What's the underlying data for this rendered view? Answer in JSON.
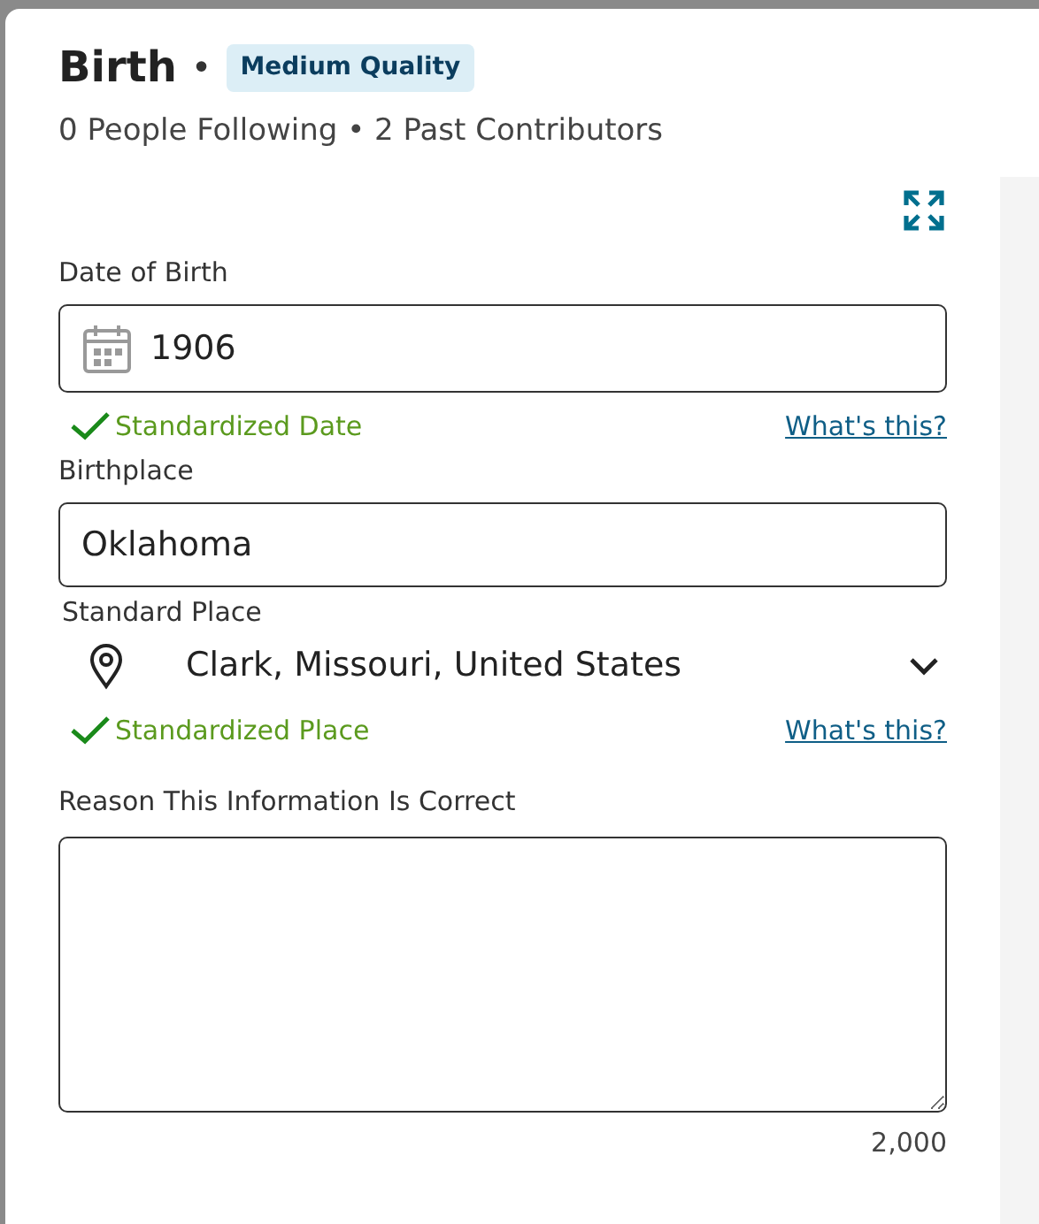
{
  "header": {
    "title": "Birth",
    "separator": "•",
    "quality_badge": "Medium Quality",
    "stats": "0 People Following • 2 Past Contributors"
  },
  "date_field": {
    "label": "Date of Birth",
    "value": "1906",
    "status": "Standardized Date",
    "help_link": "What's this?"
  },
  "place_field": {
    "label": "Birthplace",
    "value": "Oklahoma",
    "standard_label": "Standard Place",
    "standard_value": "Clark, Missouri, United States",
    "status": "Standardized Place",
    "help_link": "What's this?"
  },
  "reason_field": {
    "label": "Reason This Information Is Correct",
    "remaining": "2,000"
  }
}
